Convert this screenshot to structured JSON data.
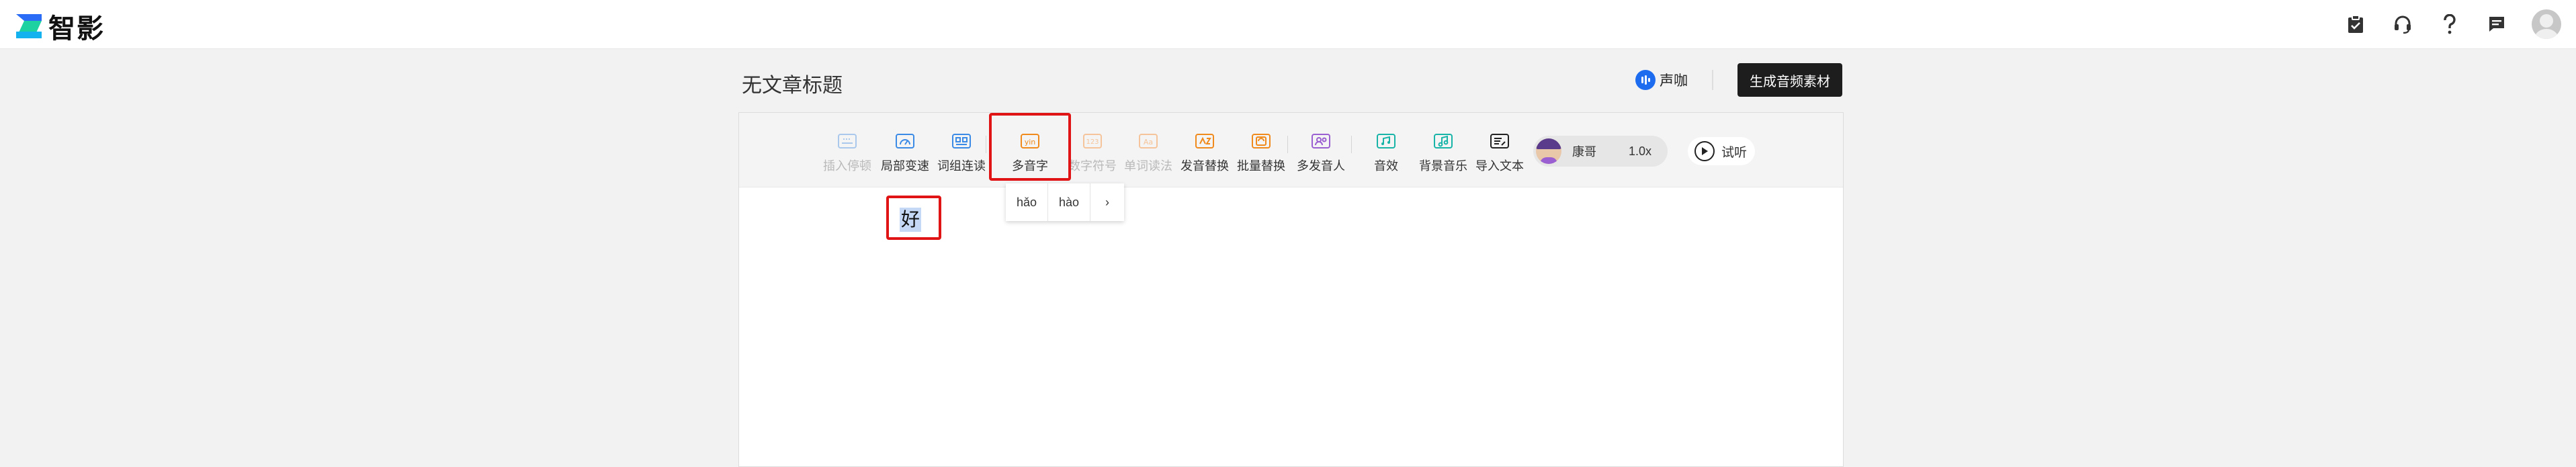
{
  "app": {
    "name": "智影"
  },
  "header_icons": [
    "clipboard-icon",
    "headset-icon",
    "help-icon",
    "message-icon",
    "avatar"
  ],
  "doc": {
    "title": "无文章标题"
  },
  "voice_brand": {
    "label": "声咖"
  },
  "generate_button": {
    "label": "生成音频素材"
  },
  "toolbar": {
    "tools": [
      {
        "id": "insert-pause",
        "label": "插入停顿",
        "disabled": true
      },
      {
        "id": "local-speed",
        "label": "局部变速",
        "disabled": false
      },
      {
        "id": "word-join",
        "label": "词组连读",
        "disabled": false
      },
      {
        "id": "polyphone",
        "label": "多音字",
        "disabled": false
      },
      {
        "id": "number-symbol",
        "label": "数字符号",
        "disabled": true
      },
      {
        "id": "word-read",
        "label": "单词读法",
        "disabled": true
      },
      {
        "id": "pron-replace",
        "label": "发音替换",
        "disabled": false
      },
      {
        "id": "batch-replace",
        "label": "批量替换",
        "disabled": false
      },
      {
        "id": "multi-speaker",
        "label": "多发音人",
        "disabled": false
      },
      {
        "id": "sound-effect",
        "label": "音效",
        "disabled": false
      },
      {
        "id": "bg-music",
        "label": "背景音乐",
        "disabled": false
      },
      {
        "id": "import-text",
        "label": "导入文本",
        "disabled": false
      }
    ],
    "speaker": {
      "name": "康哥",
      "speed": "1.0x"
    },
    "trial": {
      "label": "试听"
    }
  },
  "pinyin_popup": {
    "options": [
      "hǎo",
      "hào"
    ],
    "more": "›"
  },
  "editor": {
    "selected_word": "好"
  },
  "colors": {
    "brand": "#1dd1a1",
    "accent_orange": "#f08a1c",
    "highlight_red": "#e01414",
    "dark_button": "#1d1d1d"
  }
}
